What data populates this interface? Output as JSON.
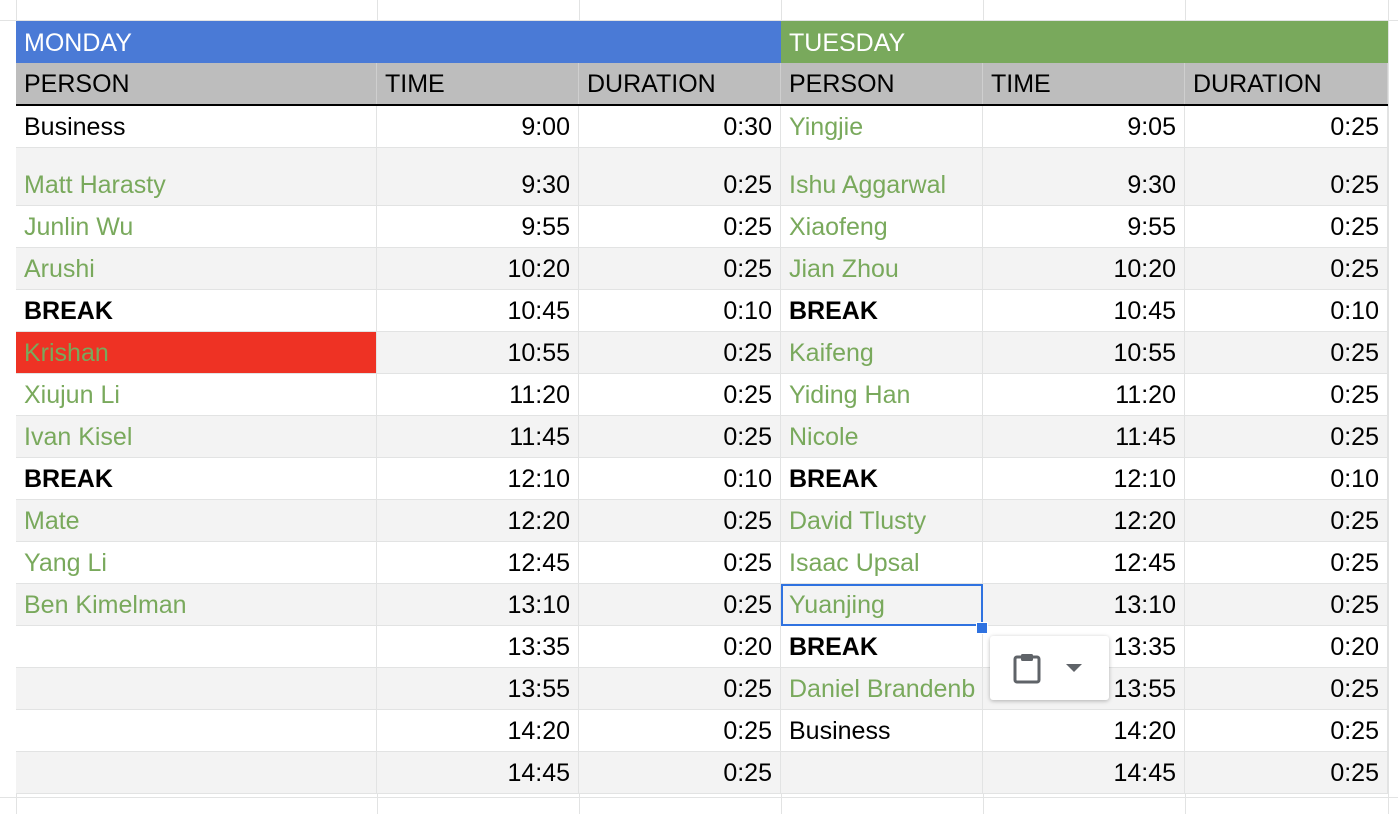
{
  "days": {
    "monday": "MONDAY",
    "tuesday": "TUESDAY"
  },
  "columns": {
    "person": "PERSON",
    "time": "TIME",
    "duration": "DURATION"
  },
  "colors": {
    "monday_header": "#4a7ad6",
    "tuesday_header": "#79a95c",
    "name_text": "#79a95c",
    "highlight": "#ee3224",
    "selection": "#2f72e0"
  },
  "rows": [
    {
      "mon": {
        "person": "Business",
        "style": "plain",
        "time": "9:00",
        "duration": "0:30"
      },
      "tue": {
        "person": "Yingjie",
        "style": "green",
        "time": "9:05",
        "duration": "0:25"
      }
    },
    {
      "mon": {
        "person": "Matt Harasty",
        "style": "green",
        "time": "9:30",
        "duration": "0:25"
      },
      "tue": {
        "person": "Ishu Aggarwal",
        "style": "green",
        "time": "9:30",
        "duration": "0:25"
      }
    },
    {
      "mon": {
        "person": "Junlin Wu",
        "style": "green",
        "time": "9:55",
        "duration": "0:25"
      },
      "tue": {
        "person": "Xiaofeng",
        "style": "green",
        "time": "9:55",
        "duration": "0:25"
      }
    },
    {
      "mon": {
        "person": "Arushi",
        "style": "green",
        "time": "10:20",
        "duration": "0:25"
      },
      "tue": {
        "person": "Jian Zhou",
        "style": "green",
        "time": "10:20",
        "duration": "0:25"
      }
    },
    {
      "mon": {
        "person": "BREAK",
        "style": "bold",
        "time": "10:45",
        "duration": "0:10"
      },
      "tue": {
        "person": "BREAK",
        "style": "bold",
        "time": "10:45",
        "duration": "0:10"
      }
    },
    {
      "mon": {
        "person": "Krishan",
        "style": "green-red",
        "time": "10:55",
        "duration": "0:25"
      },
      "tue": {
        "person": "Kaifeng",
        "style": "green",
        "time": "10:55",
        "duration": "0:25"
      }
    },
    {
      "mon": {
        "person": "Xiujun Li",
        "style": "green",
        "time": "11:20",
        "duration": "0:25"
      },
      "tue": {
        "person": "Yiding Han",
        "style": "green",
        "time": "11:20",
        "duration": "0:25"
      }
    },
    {
      "mon": {
        "person": "Ivan Kisel",
        "style": "green",
        "time": "11:45",
        "duration": "0:25"
      },
      "tue": {
        "person": "Nicole",
        "style": "green",
        "time": "11:45",
        "duration": "0:25"
      }
    },
    {
      "mon": {
        "person": "BREAK",
        "style": "bold",
        "time": "12:10",
        "duration": "0:10"
      },
      "tue": {
        "person": "BREAK",
        "style": "bold",
        "time": "12:10",
        "duration": "0:10"
      }
    },
    {
      "mon": {
        "person": "Mate",
        "style": "green",
        "time": "12:20",
        "duration": "0:25"
      },
      "tue": {
        "person": "David Tlusty",
        "style": "green",
        "time": "12:20",
        "duration": "0:25"
      }
    },
    {
      "mon": {
        "person": "Yang Li",
        "style": "green",
        "time": "12:45",
        "duration": "0:25"
      },
      "tue": {
        "person": "Isaac Upsal",
        "style": "green",
        "time": "12:45",
        "duration": "0:25"
      }
    },
    {
      "mon": {
        "person": "Ben Kimelman",
        "style": "green",
        "time": "13:10",
        "duration": "0:25"
      },
      "tue": {
        "person": "Yuanjing",
        "style": "green-selected",
        "time": "13:10",
        "duration": "0:25"
      }
    },
    {
      "mon": {
        "person": "",
        "style": "plain",
        "time": "13:35",
        "duration": "0:20"
      },
      "tue": {
        "person": "BREAK",
        "style": "bold",
        "time": "13:35",
        "duration": "0:20"
      }
    },
    {
      "mon": {
        "person": "",
        "style": "plain",
        "time": "13:55",
        "duration": "0:25"
      },
      "tue": {
        "person": "Daniel Brandenb",
        "style": "green",
        "time": "13:55",
        "duration": "0:25"
      }
    },
    {
      "mon": {
        "person": "",
        "style": "plain",
        "time": "14:20",
        "duration": "0:25"
      },
      "tue": {
        "person": "Business",
        "style": "plain",
        "time": "14:20",
        "duration": "0:25"
      }
    },
    {
      "mon": {
        "person": "",
        "style": "plain",
        "time": "14:45",
        "duration": "0:25"
      },
      "tue": {
        "person": "",
        "style": "plain",
        "time": "14:45",
        "duration": "0:25"
      }
    }
  ],
  "paste_popup": {
    "icon": "clipboard-icon",
    "menu_icon": "caret-down-icon"
  }
}
